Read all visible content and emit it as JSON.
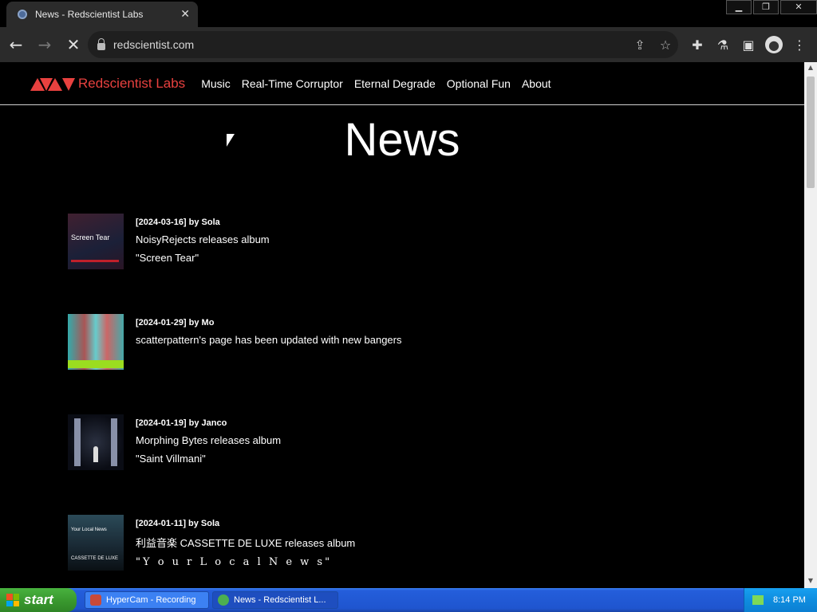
{
  "browser": {
    "tab_title": "News - Redscientist Labs",
    "url": "redscientist.com",
    "window_controls": {
      "minimize": "▁",
      "restore": "❐",
      "close": "✕"
    }
  },
  "site": {
    "logo_text": "Redscientist Labs",
    "nav": [
      "Music",
      "Real-Time Corruptor",
      "Eternal Degrade",
      "Optional Fun",
      "About"
    ],
    "page_title": "News"
  },
  "news": [
    {
      "meta": "[2024-03-16] by Sola",
      "line1": "NoisyRejects releases album",
      "line2": "\"Screen Tear\"",
      "thumb_label": "Screen Tear"
    },
    {
      "meta": "[2024-01-29] by Mo",
      "line1": "scatterpattern's page has been updated with new bangers",
      "line2": ""
    },
    {
      "meta": "[2024-01-19] by Janco",
      "line1": "Morphing Bytes releases album",
      "line2": "\"Saint Villmani\""
    },
    {
      "meta": "[2024-01-11] by Sola",
      "line1": "利益音楽 CASSETTE DE LUXE releases album",
      "line2": "\"Y o u r  L o c a l  N e w s\"",
      "thumb_label_top": "Your Local News",
      "thumb_label_bottom": "CASSETTE DE LUXE"
    }
  ],
  "taskbar": {
    "start_label": "start",
    "items": [
      {
        "label": "HyperCam - Recording"
      },
      {
        "label": "News - Redscientist L..."
      }
    ],
    "clock": "8:14 PM"
  },
  "colors": {
    "brand_red": "#e8413f",
    "background": "#000000",
    "taskbar_blue": "#245edb"
  }
}
